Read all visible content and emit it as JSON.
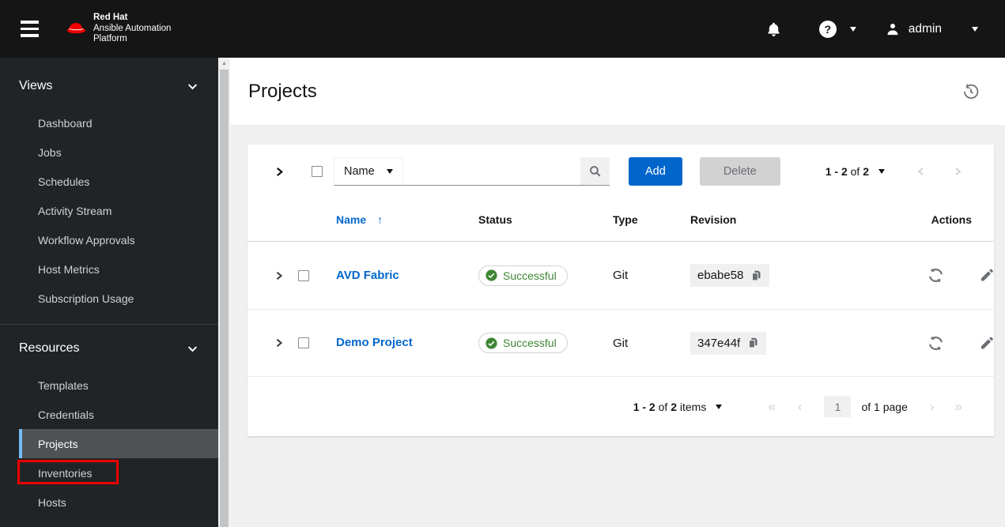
{
  "masthead": {
    "brand": {
      "line1": "Red Hat",
      "line2": "Ansible Automation",
      "line3": "Platform"
    },
    "user": "admin"
  },
  "icons": {
    "question": "?",
    "sort_asc": "↑",
    "scroll_up": "▲",
    "angle_double_left": "«",
    "angle_left": "‹",
    "angle_right": "›",
    "angle_double_right": "»"
  },
  "sidebar": {
    "groups": [
      {
        "label": "Views",
        "items": [
          "Dashboard",
          "Jobs",
          "Schedules",
          "Activity Stream",
          "Workflow Approvals",
          "Host Metrics",
          "Subscription Usage"
        ]
      },
      {
        "label": "Resources",
        "items": [
          "Templates",
          "Credentials",
          "Projects",
          "Inventories",
          "Hosts"
        ]
      }
    ],
    "selected_item": "Projects",
    "highlighted_item": "Inventories"
  },
  "page": {
    "title": "Projects"
  },
  "toolbar": {
    "filter_label": "Name",
    "add_label": "Add",
    "delete_label": "Delete",
    "pagination": {
      "range": "1 - 2",
      "of_label": "of",
      "total": "2"
    }
  },
  "table": {
    "headers": {
      "name": "Name",
      "status": "Status",
      "type": "Type",
      "revision": "Revision",
      "actions": "Actions"
    },
    "rows": [
      {
        "name": "AVD Fabric",
        "status": "Successful",
        "type": "Git",
        "revision": "ebabe58"
      },
      {
        "name": "Demo Project",
        "status": "Successful",
        "type": "Git",
        "revision": "347e44f"
      }
    ]
  },
  "footer": {
    "range": "1 - 2",
    "of_label": "of",
    "total": "2",
    "items_label": "items",
    "page_value": "1",
    "page_label": "of 1 page"
  },
  "colors": {
    "accent": "#0066cc",
    "success": "#3e8635",
    "selected_bar": "#73bcf7",
    "annotation": "#ee0000",
    "masthead_bg": "#151515",
    "sidebar_bg": "#212427"
  }
}
